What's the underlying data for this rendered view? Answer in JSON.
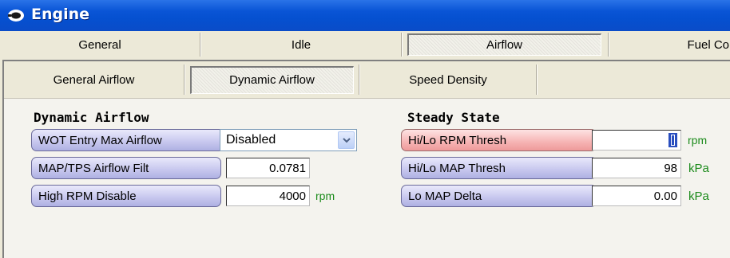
{
  "window": {
    "title": "Engine",
    "icon": "engine-icon"
  },
  "top_tabs": [
    {
      "label": "General",
      "selected": false
    },
    {
      "label": "Idle",
      "selected": false
    },
    {
      "label": "Airflow",
      "selected": true
    },
    {
      "label": "Fuel Cor",
      "selected": false
    }
  ],
  "sub_tabs": [
    {
      "label": "General Airflow",
      "selected": false
    },
    {
      "label": "Dynamic Airflow",
      "selected": true
    },
    {
      "label": "Speed Density",
      "selected": false
    }
  ],
  "dynamic_airflow": {
    "title": "Dynamic Airflow",
    "wot_entry": {
      "label": "WOT Entry Max Airflow",
      "value": "Disabled"
    },
    "map_tps_filt": {
      "label": "MAP/TPS Airflow Filt",
      "value": "0.0781"
    },
    "high_rpm_disable": {
      "label": "High RPM Disable",
      "value": "4000",
      "unit": "rpm"
    }
  },
  "steady_state": {
    "title": "Steady State",
    "hi_lo_rpm": {
      "label": "Hi/Lo RPM Thresh",
      "value": "0",
      "unit": "rpm"
    },
    "hi_lo_map": {
      "label": "Hi/Lo MAP Thresh",
      "value": "98",
      "unit": "kPa"
    },
    "lo_map_delta": {
      "label": "Lo MAP Delta",
      "value": "0.00",
      "unit": "kPa"
    }
  },
  "colors": {
    "title_bar": "#0a55d6",
    "unit_text": "#1a8a1a",
    "pill_blue": "#c9c9ef",
    "pill_red": "#f6b3b3"
  }
}
